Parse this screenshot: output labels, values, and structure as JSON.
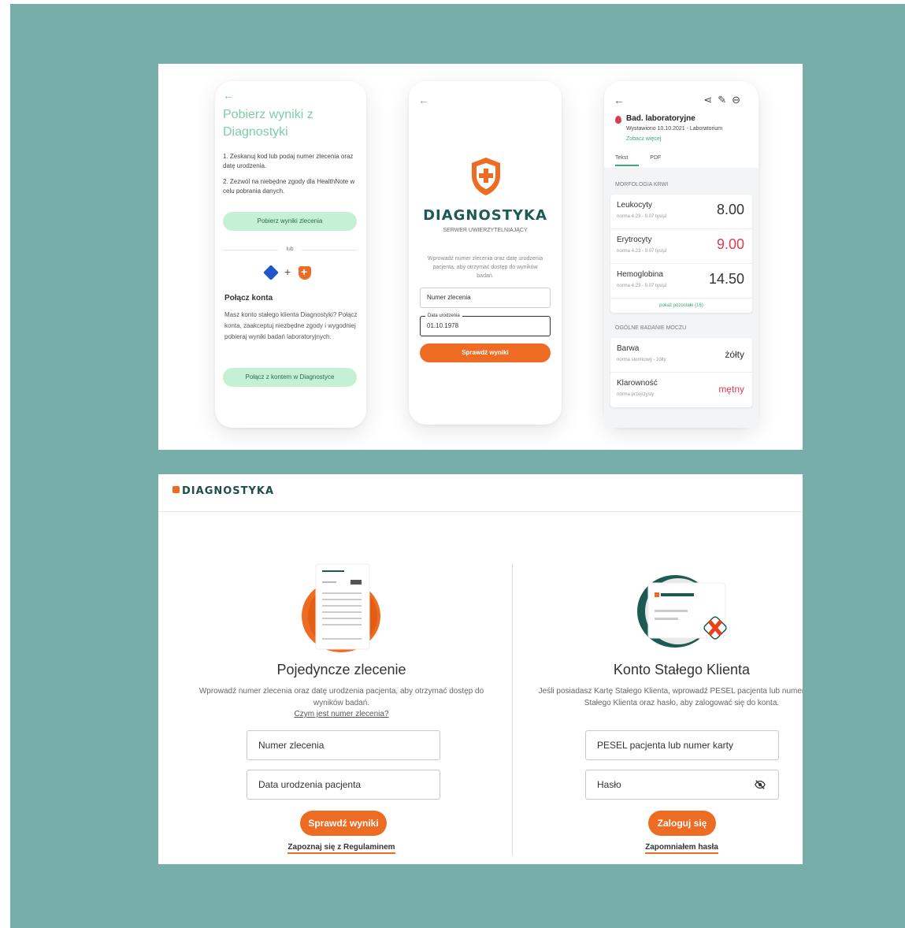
{
  "phone1": {
    "title": "Pobierz wyniki z Diagnostyki",
    "step1": "1. Zeskanuj kod lub podaj numer zlecenia oraz datę urodzenia.",
    "step2": "2. Zezwól na niebędne zgody dla HealthNote w celu pobrania danych.",
    "download_button": "Pobierz wyniki zlecenia",
    "or_label": "lub",
    "connect_title": "Połącz konta",
    "connect_desc": "Masz konto stałego klienta Diagnostyki? Połącz konta, zaakceptuj niezbędne zgody i wygodniej pobieraj wyniki badań laboratoryjnych.",
    "connect_button": "Połącz z kontem w Diagnostyce"
  },
  "phone2": {
    "brand": "DIAGNOSTYKA",
    "subtitle": "SERWER UWIERZYTELNIAJĄCY",
    "info": "Wprowadź numer zlecenia oraz datę urodzenia pacjenta, aby otrzymać dostęp do wyników badań.",
    "order_field": "Numer zlecenia",
    "birth_label": "Data urodzenia",
    "birth_value": "01.10.1978",
    "check_button": "Sprawdź wyniki"
  },
  "phone3": {
    "title": "Bad. laboratoryjne",
    "issued": "Wystawiono 10.10.2021 - Laboratorium",
    "see_more": "Zobacz więcej",
    "tabs": [
      "Tekst",
      "PDF"
    ],
    "section1": "MORFOLOGIA KRWI",
    "rows1": [
      {
        "name": "Leukocyty",
        "norm": "norma 4.23 - 9.07 tys/µl",
        "value": "8.00"
      },
      {
        "name": "Erytrocyty",
        "norm": "norma 4.23 - 9.07 tys/µl",
        "value": "9.00"
      },
      {
        "name": "Hemoglobina",
        "norm": "norma 4.23 - 9.07 tys/µl",
        "value": "14.50"
      }
    ],
    "show_rest": "pokaż pozostałe (16)",
    "section2": "OGÓLNE BADANIE MOCZU",
    "rows2": [
      {
        "name": "Barwa",
        "norm": "norma słomkowy - żółty",
        "value": "żółty"
      },
      {
        "name": "Klarowność",
        "norm": "norma przejrzysty",
        "value": "mętny"
      }
    ],
    "colors": {
      "alert": "#e03a53",
      "accent": "#3da87b"
    }
  },
  "web": {
    "logo": "DIAGNOSTYKA",
    "left": {
      "title": "Pojedyncze zlecenie",
      "desc": "Wprowadź numer zlecenia oraz datę urodzenia pacjenta, aby otrzymać dostęp do wyników badań.",
      "help_link": "Czym jest numer zlecenia?",
      "order_placeholder": "Numer zlecenia",
      "birth_placeholder": "Data urodzenia pacjenta",
      "button": "Sprawdź wyniki",
      "terms_link": "Zapoznaj się z Regulaminem"
    },
    "right": {
      "title": "Konto Stałego Klienta",
      "desc": "Jeśli posiadasz Kartę Stałego Klienta, wprowadź PESEL pacjenta lub numer Karty Stałego Klienta oraz hasło, aby zalogować się do konta.",
      "pesel_placeholder": "PESEL pacjenta lub numer karty",
      "password_placeholder": "Hasło",
      "button": "Zaloguj się",
      "forgot_link": "Zapomniałem hasła"
    },
    "colors": {
      "brand": "#ee6b24",
      "dark": "#1d4e4a",
      "background": "#77aeaa"
    }
  }
}
